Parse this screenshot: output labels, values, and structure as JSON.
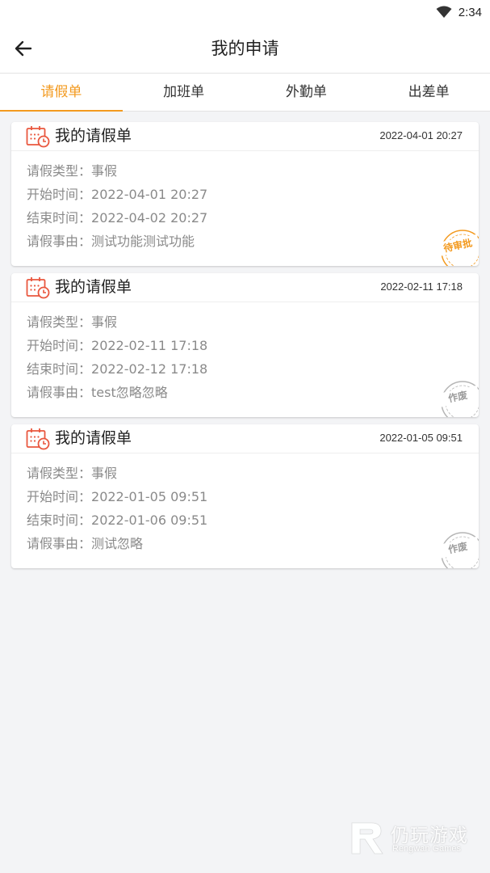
{
  "status_bar": {
    "time": "2:34",
    "wifi_icon": "wifi-icon"
  },
  "app_bar": {
    "back_icon": "arrow-left-icon",
    "title": "我的申请"
  },
  "tabs": [
    {
      "label": "请假单",
      "active": true
    },
    {
      "label": "加班单",
      "active": false
    },
    {
      "label": "外勤单",
      "active": false
    },
    {
      "label": "出差单",
      "active": false
    }
  ],
  "colors": {
    "accent": "#f39a1f",
    "card_icon": "#e9573f",
    "stamp_pending": "#f39a1f",
    "stamp_void": "#b5b5b5"
  },
  "cards": [
    {
      "title": "我的请假单",
      "time": "2022-04-01 20:27",
      "rows": [
        {
          "k": "请假类型：",
          "v": "事假"
        },
        {
          "k": "开始时间：",
          "v": "2022-04-01 20:27"
        },
        {
          "k": "结束时间：",
          "v": "2022-04-02 20:27"
        },
        {
          "k": "请假事由：",
          "v": "测试功能测试功能"
        }
      ],
      "stamp": "待审批"
    },
    {
      "title": "我的请假单",
      "time": "2022-02-11 17:18",
      "rows": [
        {
          "k": "请假类型：",
          "v": "事假"
        },
        {
          "k": "开始时间：",
          "v": "2022-02-11 17:18"
        },
        {
          "k": "结束时间：",
          "v": "2022-02-12 17:18"
        },
        {
          "k": "请假事由：",
          "v": "test忽略忽略"
        }
      ],
      "stamp": "作废"
    },
    {
      "title": "我的请假单",
      "time": "2022-01-05 09:51",
      "rows": [
        {
          "k": "请假类型：",
          "v": "事假"
        },
        {
          "k": "开始时间：",
          "v": "2022-01-05 09:51"
        },
        {
          "k": "结束时间：",
          "v": "2022-01-06 09:51"
        },
        {
          "k": "请假事由：",
          "v": "测试忽略"
        }
      ],
      "stamp": "作废"
    }
  ],
  "watermark": {
    "name": "仍玩游戏",
    "sub": "Rengwan Games"
  }
}
